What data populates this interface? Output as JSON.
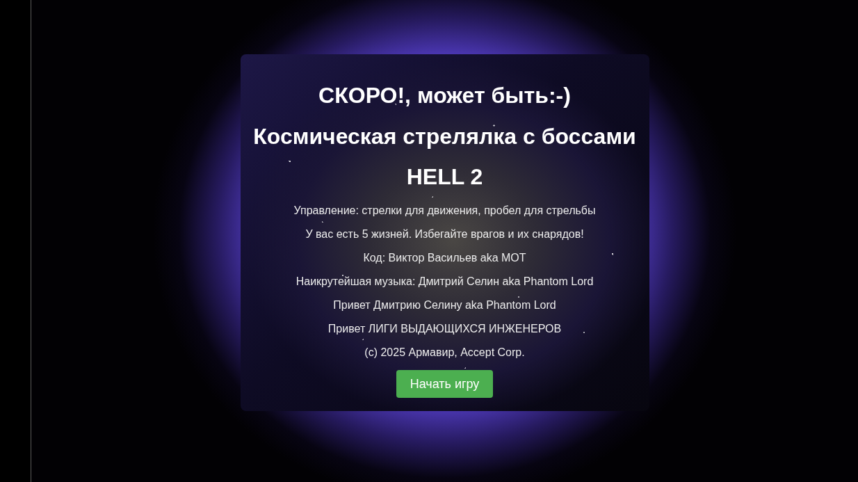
{
  "panel": {
    "headings": [
      "СКОРО!, может быть:-)",
      "Космическая стрелялка с боссами",
      "HELL 2"
    ],
    "info_lines": [
      "Управление: стрелки для движения, пробел для стрельбы",
      "У вас есть 5 жизней. Избегайте врагов и их снарядов!",
      "Код: Виктор Васильев aka MOT",
      "Наикрутейшая музыка: Дмитрий Селин aka Phantom Lord",
      "Привет Дмитрию Селину aka Phantom Lord",
      "Привет ЛИГИ ВЫДАЮЩИХСЯ ИНЖЕНЕРОВ",
      "(c) 2025 Армавир, Accept Corp."
    ],
    "start_button": {
      "label": "Начать игру"
    }
  }
}
